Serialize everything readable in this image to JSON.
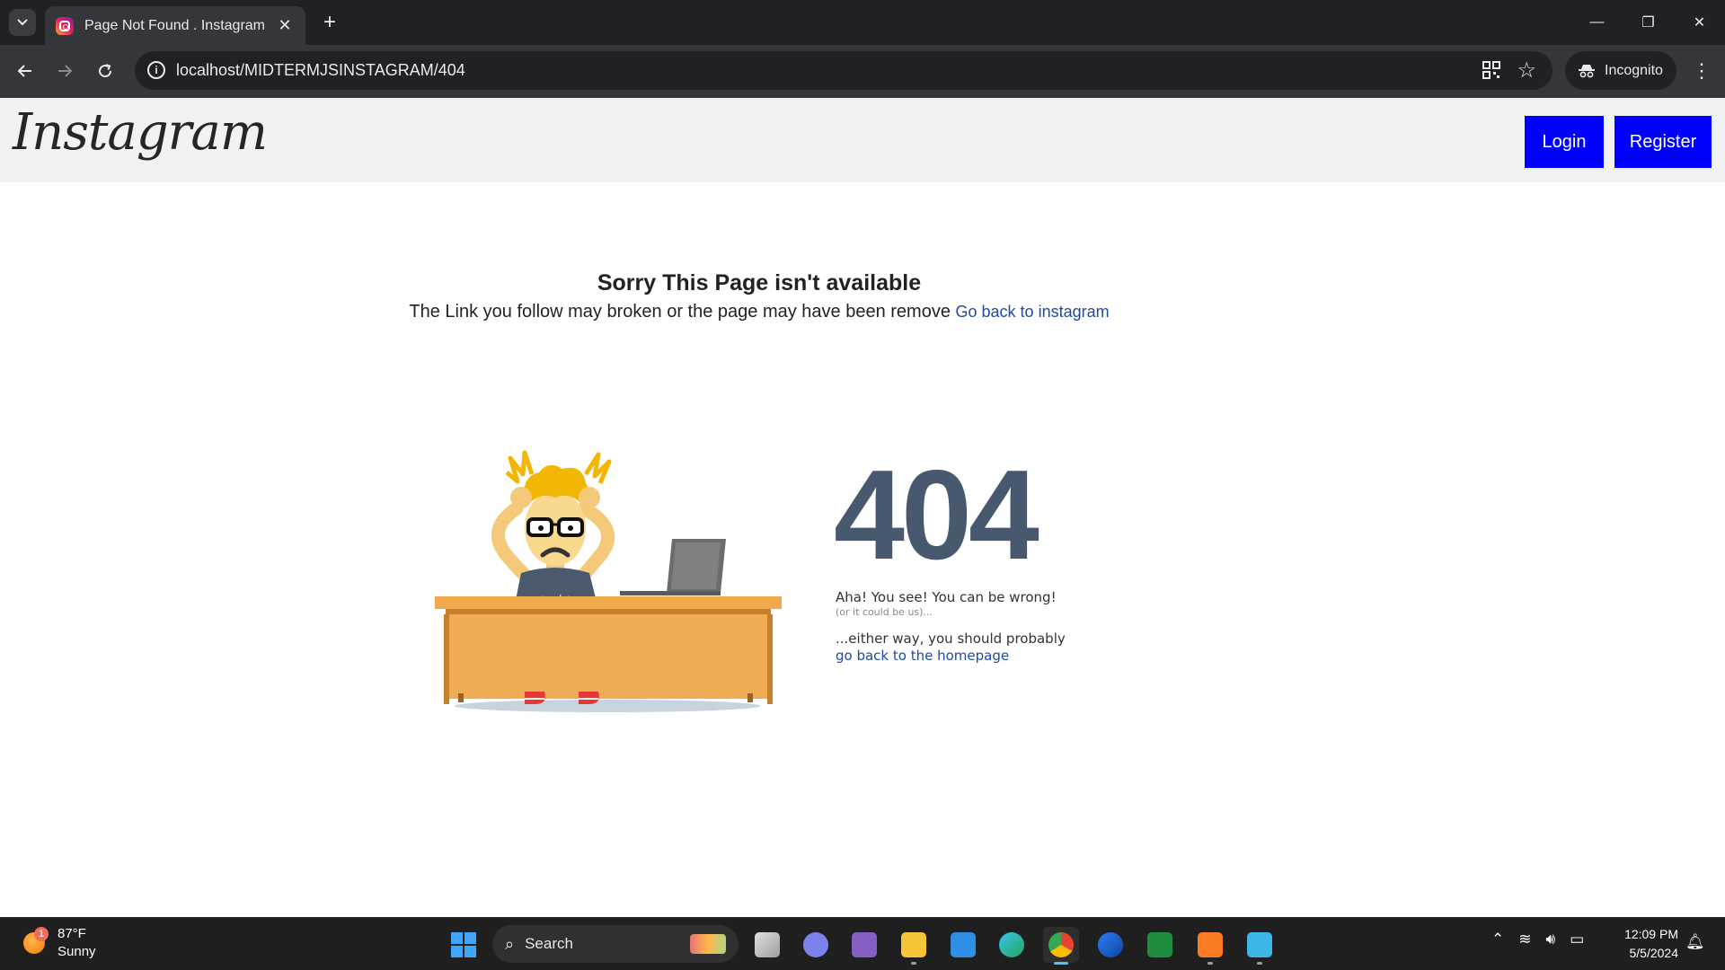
{
  "browser": {
    "tab_title": "Page Not Found . Instagram",
    "url": "localhost/MIDTERMJSINSTAGRAM/404",
    "incognito_label": "Incognito"
  },
  "site": {
    "logo_text": "Instagram",
    "login_label": "Login",
    "register_label": "Register"
  },
  "error": {
    "headline": "Sorry This Page isn't available",
    "message": "The Link you follow may broken or the page may have been remove",
    "back_link": "Go back to instagram",
    "code": "404",
    "shirt_text": "< codr >",
    "line1": "Aha! You see! You can be wrong!",
    "line2": "(or it could be us)...",
    "line3": "...either way, you should probably",
    "homepage_link": "go back to the homepage"
  },
  "taskbar": {
    "weather_temp": "87°F",
    "weather_desc": "Sunny",
    "weather_badge": "1",
    "search_placeholder": "Search",
    "time": "12:09 PM",
    "date": "5/5/2024"
  },
  "colors": {
    "brand_button": "#0000ff",
    "code_color": "#48596f",
    "link_color": "#1d4ba4"
  }
}
